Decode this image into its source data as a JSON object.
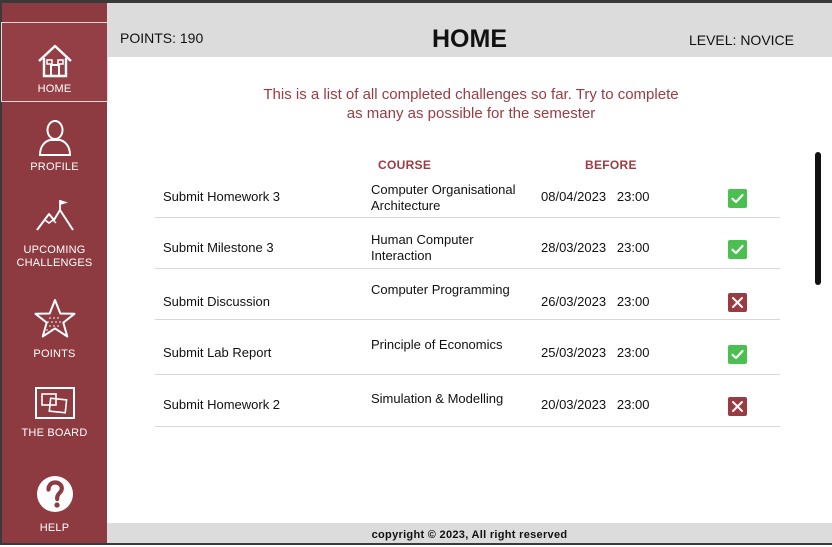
{
  "header": {
    "points": "POINTS: 190",
    "title": "HOME",
    "level": "LEVEL: NOVICE"
  },
  "sidebar": {
    "items": [
      {
        "label": "HOME",
        "icon": "home-icon"
      },
      {
        "label": "PROFILE",
        "icon": "profile-icon"
      },
      {
        "label": "UPCOMING CHALLENGES",
        "icon": "mountain-flag-icon"
      },
      {
        "label": "POINTS",
        "icon": "star-icon"
      },
      {
        "label": "THE BOARD",
        "icon": "board-icon"
      },
      {
        "label": "HELP",
        "icon": "help-icon"
      }
    ]
  },
  "main": {
    "intro": "This is a list of all completed challenges so far. Try to complete as many as possible for the semester",
    "columns": {
      "course": "COURSE",
      "before": "BEFORE"
    },
    "rows": [
      {
        "task": "Submit Homework 3",
        "course": "Computer Organisational Architecture",
        "date": "08/04/2023   23:00",
        "status": "complete"
      },
      {
        "task": "Submit Milestone 3",
        "course": "Human Computer Interaction",
        "date": "28/03/2023   23:00",
        "status": "complete"
      },
      {
        "task": "Submit Discussion",
        "course": "Computer Programming",
        "date": "26/03/2023   23:00",
        "status": "missed"
      },
      {
        "task": "Submit Lab Report",
        "course": "Principle of Economics",
        "date": "25/03/2023   23:00",
        "status": "complete"
      },
      {
        "task": "Submit Homework 2",
        "course": "Simulation & Modelling",
        "date": "20/03/2023   23:00",
        "status": "missed"
      }
    ]
  },
  "footer": {
    "copyright": "copyright © 2023, All right reserved"
  },
  "colors": {
    "sidebar": "#8e3a41",
    "accent": "#9c3b43",
    "ok": "#4bbf4f",
    "fail": "#9a3a41",
    "bar": "#dcdcdc"
  }
}
